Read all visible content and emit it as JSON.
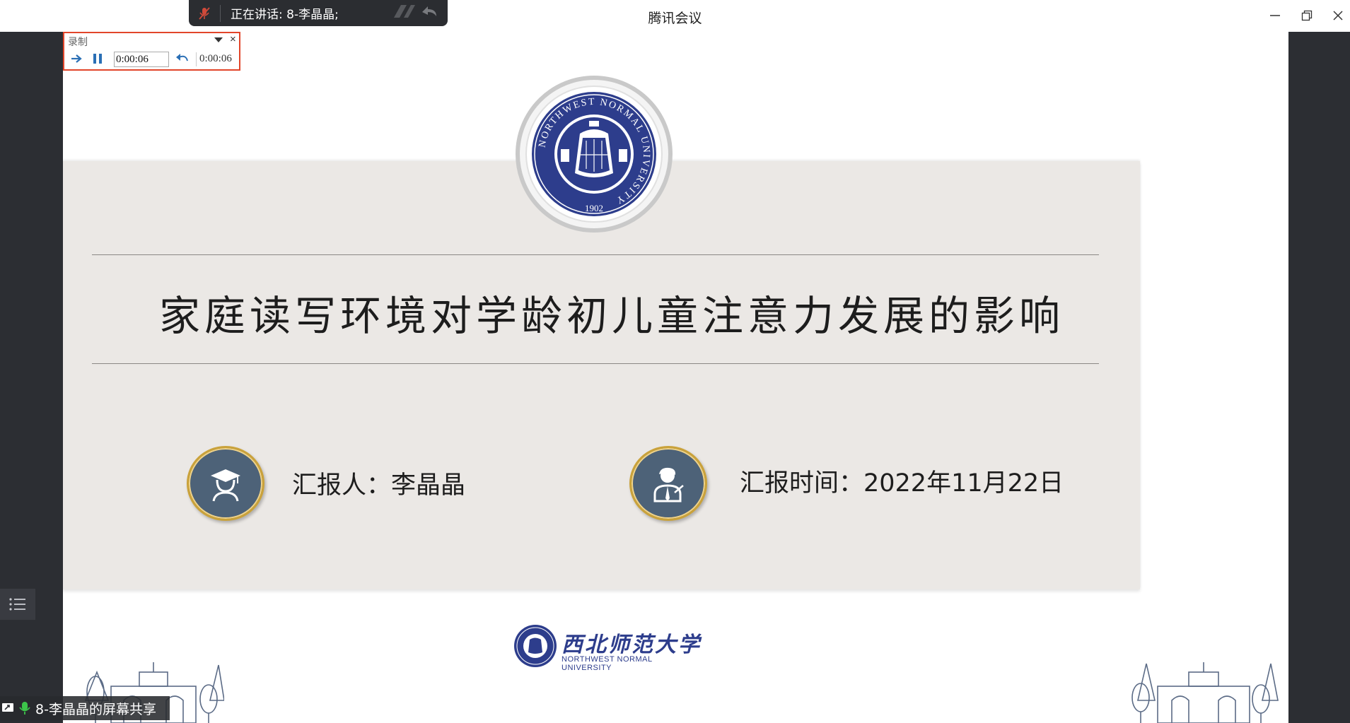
{
  "window": {
    "title": "腾讯会议",
    "controls": [
      "minimize-icon",
      "restore-icon",
      "close-icon"
    ]
  },
  "speaker": {
    "text": "正在讲话: 8-李晶晶;",
    "mic_icon": "mic-muted-icon"
  },
  "recording": {
    "label": "录制",
    "current_time": "0:00:06",
    "total_time": "0:00:06",
    "icons": [
      "arrow-right-icon",
      "pause-icon",
      "undo-icon",
      "dropdown-icon",
      "close-icon"
    ]
  },
  "slide": {
    "title": "家庭读写环境对学龄初儿童注意力发展的影响",
    "reporter": "汇报人：李晶晶",
    "report_time": "汇报时间：2022年11月22日",
    "seal": {
      "ring_text": "NORTHWEST NORMAL UNIVERSITY",
      "year": "1902"
    },
    "footer_logo": {
      "name_cn": "西北师范大学",
      "name_en": "NORTHWEST NORMAL UNIVERSITY"
    }
  },
  "share": {
    "label": "8-李晶晶的屏幕共享"
  },
  "colors": {
    "band": "#ebe8e5",
    "navy": "#2d3d8c",
    "icon_circle": "#4d6278",
    "gold_ring": "#caa23a",
    "panel": "#2c2e33",
    "record_border": "#e2452a"
  }
}
